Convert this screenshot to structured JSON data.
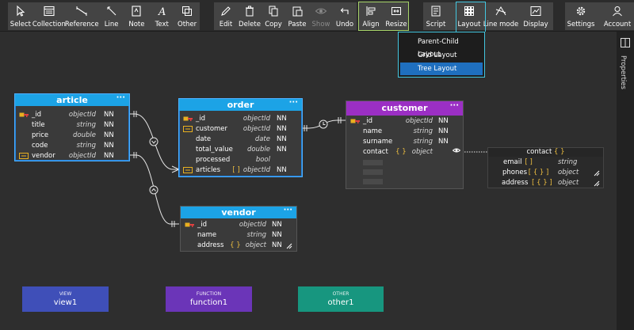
{
  "toolbar": {
    "select": "Select",
    "collection": "Collection",
    "reference": "Reference",
    "line": "Line",
    "note": "Note",
    "text": "Text",
    "other": "Other",
    "edit": "Edit",
    "delete": "Delete",
    "copy": "Copy",
    "paste": "Paste",
    "show": "Show",
    "undo": "Undo",
    "align": "Align",
    "resize": "Resize",
    "script": "Script",
    "layout": "Layout",
    "line_mode": "Line mode",
    "display": "Display",
    "settings": "Settings",
    "account": "Account"
  },
  "layout_menu": {
    "items": [
      "Parent-Child Layout",
      "Grid Layout",
      "Tree Layout"
    ],
    "active": "Tree Layout"
  },
  "side_panel": {
    "label": "Properties"
  },
  "colors": {
    "collection_header": "#1ca3e6",
    "customer_header": "#9b2fc4",
    "view": "#3f4fb8",
    "function": "#6b35b8",
    "other": "#17967f"
  },
  "collections": {
    "article": {
      "title": "article",
      "menu": "···",
      "fields": [
        {
          "icon": "primary-key-icon",
          "name": "_id",
          "type": "objectId",
          "nn": "NN"
        },
        {
          "icon": "",
          "name": "title",
          "type": "string",
          "nn": "NN"
        },
        {
          "icon": "",
          "name": "price",
          "type": "double",
          "nn": "NN"
        },
        {
          "icon": "",
          "name": "code",
          "type": "string",
          "nn": "NN"
        },
        {
          "icon": "foreign-key-icon",
          "name": "vendor",
          "type": "objectId",
          "nn": "NN"
        }
      ]
    },
    "order": {
      "title": "order",
      "menu": "···",
      "fields": [
        {
          "icon": "primary-key-icon",
          "name": "_id",
          "type": "objectId",
          "nn": "NN"
        },
        {
          "icon": "foreign-key-icon",
          "name": "customer",
          "type": "objectId",
          "nn": "NN"
        },
        {
          "icon": "",
          "name": "date",
          "type": "date",
          "nn": "NN"
        },
        {
          "icon": "",
          "name": "total_value",
          "type": "double",
          "nn": "NN"
        },
        {
          "icon": "",
          "name": "processed",
          "type": "bool",
          "nn": ""
        },
        {
          "icon": "foreign-key-icon",
          "name": "articles",
          "bracket": "[ ]",
          "type": "objectId",
          "nn": "NN"
        }
      ]
    },
    "customer": {
      "title": "customer",
      "menu": "···",
      "fields": [
        {
          "icon": "primary-key-icon",
          "name": "_id",
          "type": "objectId",
          "nn": "NN"
        },
        {
          "icon": "",
          "name": "name",
          "type": "string",
          "nn": "NN"
        },
        {
          "icon": "",
          "name": "surname",
          "type": "string",
          "nn": "NN"
        },
        {
          "icon": "",
          "name": "contact",
          "bracket": "{ }",
          "type": "object",
          "nn": ""
        }
      ]
    },
    "vendor": {
      "title": "vendor",
      "menu": "···",
      "fields": [
        {
          "icon": "primary-key-icon",
          "name": "_id",
          "type": "objectId",
          "nn": "NN"
        },
        {
          "icon": "",
          "name": "name",
          "type": "string",
          "nn": "NN"
        },
        {
          "icon": "",
          "name": "address",
          "bracket": "{ }",
          "type": "object",
          "nn": "NN"
        }
      ]
    }
  },
  "contact_sub": {
    "title": "contact",
    "title_bracket": "{ }",
    "fields": [
      {
        "name": "email",
        "bracket": "[ ]",
        "type": "string"
      },
      {
        "name": "phones",
        "bracket": "[ { } ]",
        "type": "object"
      },
      {
        "name": "address",
        "bracket": "[ { } ]",
        "type": "object"
      }
    ]
  },
  "other_objects": {
    "view": {
      "type": "VIEW",
      "name": "view1"
    },
    "function": {
      "type": "FUNCTION",
      "name": "function1"
    },
    "other": {
      "type": "OTHER",
      "name": "other1"
    }
  }
}
